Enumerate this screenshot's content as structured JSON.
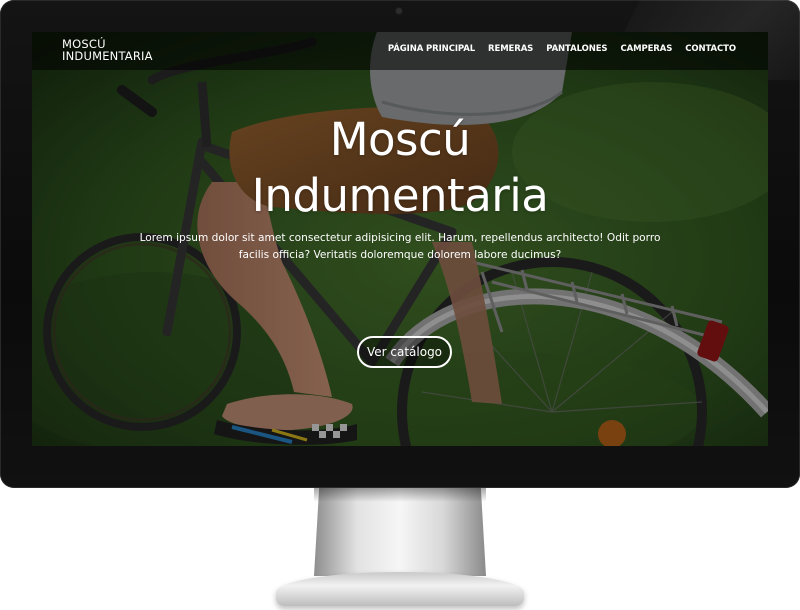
{
  "site": {
    "brand": {
      "line1": "MOSCÚ",
      "line2": "INDUMENTARIA"
    },
    "nav": [
      {
        "label": "PÁGINA PRINCIPAL"
      },
      {
        "label": "REMERAS"
      },
      {
        "label": "PANTALONES"
      },
      {
        "label": "CAMPERAS"
      },
      {
        "label": "CONTACTO"
      }
    ],
    "hero": {
      "title_line1": "Moscú",
      "title_line2": "Indumentaria",
      "description": "Lorem ipsum dolor sit amet consectetur adipisicing elit. Harum, repellendus architecto! Odit porro facilis officia? Veritatis doloremque dolorem labore ducimus?",
      "cta_label": "Ver catálogo",
      "background_subject": "person riding a bicycle on grass"
    }
  },
  "colors": {
    "bezel": "#0d0d0d",
    "navbar_bg": "#000000",
    "text": "#ffffff",
    "grass": "#3f6b2a",
    "shorts": "#8a5a2b",
    "shirt": "#a9adb0"
  }
}
